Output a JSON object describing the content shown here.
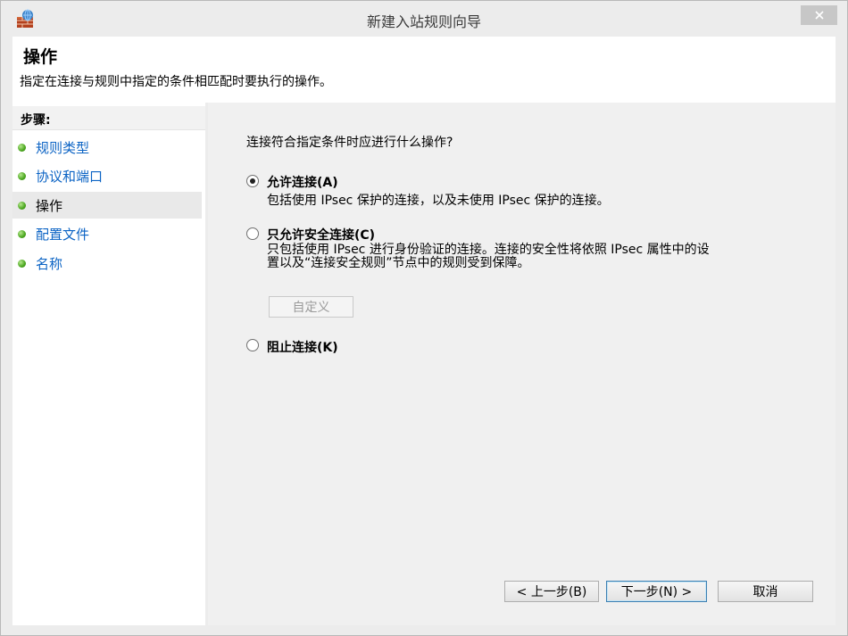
{
  "window": {
    "title": "新建入站规则向导",
    "colors": {
      "link": "#0b63c4",
      "bullet": "#49a51d",
      "close_bg": "#c7c7c7"
    }
  },
  "icons": {
    "app": "firewall-icon",
    "close": "close-icon",
    "step_bullet": "green-bullet-icon"
  },
  "header": {
    "title": "操作",
    "description": "指定在连接与规则中指定的条件相匹配时要执行的操作。"
  },
  "steps": {
    "title": "步骤:",
    "items": [
      {
        "label": "规则类型"
      },
      {
        "label": "协议和端口"
      },
      {
        "label": "操作",
        "active": true
      },
      {
        "label": "配置文件"
      },
      {
        "label": "名称"
      }
    ]
  },
  "main": {
    "question": "连接符合指定条件时应进行什么操作?",
    "options": [
      {
        "label": "允许连接(A)",
        "description": "包括使用 IPsec 保护的连接，以及未使用 IPsec 保护的连接。",
        "checked": true
      },
      {
        "label": "只允许安全连接(C)",
        "description_line1": "只包括使用 IPsec 进行身份验证的连接。连接的安全性将依照 IPsec 属性中的设",
        "description_line2": "置以及“连接安全规则”节点中的规则受到保障。",
        "checked": false
      },
      {
        "label": "阻止连接(K)",
        "checked": false
      }
    ],
    "customize_label": "自定义"
  },
  "buttons": {
    "back": "< 上一步(B)",
    "next": "下一步(N) >",
    "cancel": "取消"
  }
}
